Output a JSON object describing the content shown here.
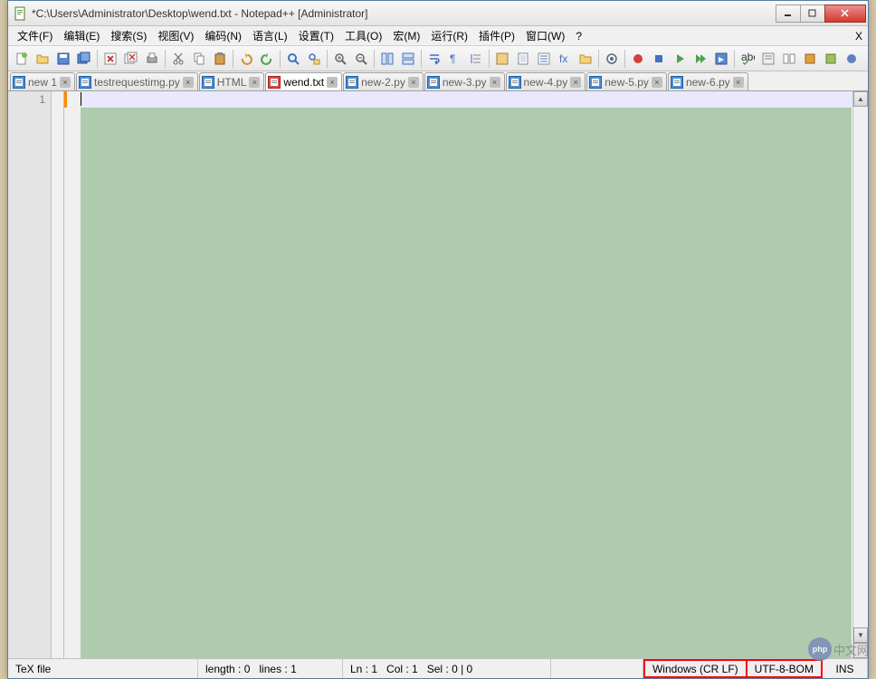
{
  "title": "*C:\\Users\\Administrator\\Desktop\\wend.txt - Notepad++ [Administrator]",
  "menus": [
    "文件(F)",
    "编辑(E)",
    "搜索(S)",
    "视图(V)",
    "编码(N)",
    "语言(L)",
    "设置(T)",
    "工具(O)",
    "宏(M)",
    "运行(R)",
    "插件(P)",
    "窗口(W)",
    "?"
  ],
  "tabs": [
    {
      "label": "new 1",
      "modified": false,
      "active": false
    },
    {
      "label": "testrequestimg.py",
      "modified": false,
      "active": false
    },
    {
      "label": "HTML",
      "modified": false,
      "active": false
    },
    {
      "label": "wend.txt",
      "modified": true,
      "active": true
    },
    {
      "label": "new-2.py",
      "modified": false,
      "active": false
    },
    {
      "label": "new-3.py",
      "modified": false,
      "active": false
    },
    {
      "label": "new-4.py",
      "modified": false,
      "active": false
    },
    {
      "label": "new-5.py",
      "modified": false,
      "active": false
    },
    {
      "label": "new-6.py",
      "modified": false,
      "active": false
    }
  ],
  "gutter_line": "1",
  "status": {
    "filetype": "TeX file",
    "length": "length : 0",
    "lines": "lines : 1",
    "ln": "Ln : 1",
    "col": "Col : 1",
    "sel": "Sel : 0 | 0",
    "eol": "Windows (CR LF)",
    "encoding": "UTF-8-BOM",
    "insmode": "INS"
  },
  "watermark": {
    "logo": "php",
    "text": "中文网"
  }
}
